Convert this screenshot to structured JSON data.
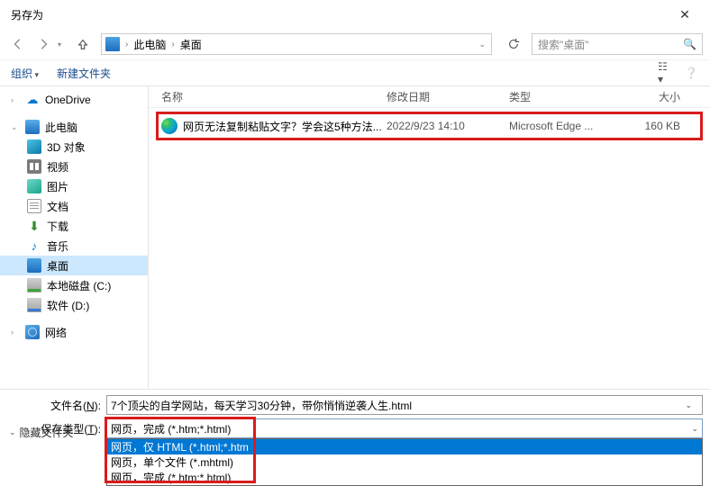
{
  "window": {
    "title": "另存为"
  },
  "breadcrumb": {
    "pc": "此电脑",
    "location": "桌面"
  },
  "search": {
    "placeholder": "搜索\"桌面\""
  },
  "toolbar": {
    "organize": "组织",
    "new_folder": "新建文件夹"
  },
  "columns": {
    "name": "名称",
    "date": "修改日期",
    "type": "类型",
    "size": "大小"
  },
  "file": {
    "name": "网页无法复制粘贴文字？学会这5种方法...",
    "date": "2022/9/23 14:10",
    "type": "Microsoft Edge ...",
    "size": "160 KB"
  },
  "sidebar": {
    "onedrive": "OneDrive",
    "this_pc": "此电脑",
    "objects3d": "3D 对象",
    "videos": "视频",
    "pictures": "图片",
    "documents": "文档",
    "downloads": "下载",
    "music": "音乐",
    "desktop": "桌面",
    "local_c": "本地磁盘 (C:)",
    "soft_d": "软件 (D:)",
    "network": "网络"
  },
  "form": {
    "filename_label_pre": "文件名(",
    "filename_label_u": "N",
    "filename_label_post": "):",
    "filetype_label_pre": "保存类型(",
    "filetype_label_u": "T",
    "filetype_label_post": "):",
    "filename_value": "7个顶尖的自学网站，每天学习30分钟，带你悄悄逆袭人生.html",
    "filetype_selected": "网页，完成 (*.htm;*.html)",
    "options": [
      "网页，仅 HTML (*.html;*.htm",
      "网页，单个文件 (*.mhtml)",
      "网页，完成 (*.htm;*.html)"
    ]
  },
  "hide_folders": "隐藏文件夹"
}
